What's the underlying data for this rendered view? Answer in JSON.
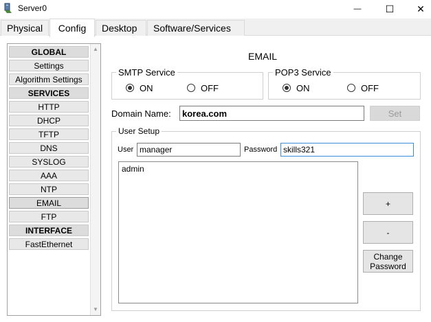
{
  "window": {
    "title": "Server0",
    "minimize": "—",
    "maximize": "☐",
    "close": "✕"
  },
  "tabs": [
    "Physical",
    "Config",
    "Desktop",
    "Software/Services"
  ],
  "active_tab": "Config",
  "sidebar": {
    "items": [
      "GLOBAL",
      "Settings",
      "Algorithm Settings",
      "SERVICES",
      "HTTP",
      "DHCP",
      "TFTP",
      "DNS",
      "SYSLOG",
      "AAA",
      "NTP",
      "EMAIL",
      "FTP",
      "INTERFACE",
      "FastEthernet"
    ],
    "headers": [
      "GLOBAL",
      "SERVICES",
      "INTERFACE"
    ],
    "selected": "EMAIL",
    "scroll_up": "▲",
    "scroll_down": "▼"
  },
  "email": {
    "title": "EMAIL",
    "smtp": {
      "legend": "SMTP Service",
      "on_label": "ON",
      "off_label": "OFF",
      "value": "ON"
    },
    "pop3": {
      "legend": "POP3 Service",
      "on_label": "ON",
      "off_label": "OFF",
      "value": "ON"
    },
    "domain_label": "Domain Name:",
    "domain_value": "korea.com",
    "set_button": "Set",
    "user_setup": {
      "legend": "User Setup",
      "user_label": "User",
      "user_value": "manager",
      "password_label": "Password",
      "password_value": "skills321",
      "users": [
        "admin"
      ],
      "add_button": "+",
      "remove_button": "-",
      "change_password_line1": "Change",
      "change_password_line2": "Password"
    }
  }
}
